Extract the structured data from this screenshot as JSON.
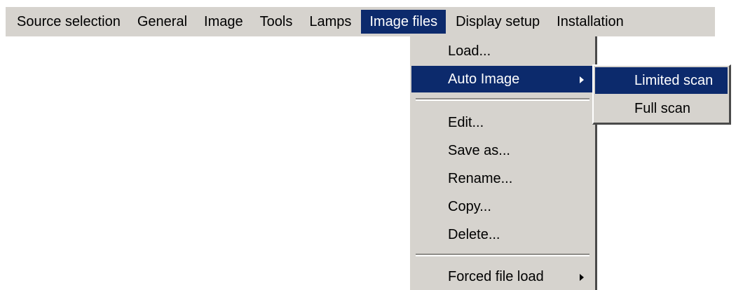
{
  "menubar": {
    "items": [
      {
        "label": "Source selection"
      },
      {
        "label": "General"
      },
      {
        "label": "Image"
      },
      {
        "label": "Tools"
      },
      {
        "label": "Lamps"
      },
      {
        "label": "Image files"
      },
      {
        "label": "Display setup"
      },
      {
        "label": "Installation"
      }
    ],
    "active_index": 5
  },
  "image_files_menu": {
    "items": [
      {
        "label": "Load..."
      },
      {
        "label": "Auto Image",
        "has_submenu": true
      },
      {
        "label": "Edit..."
      },
      {
        "label": "Save as..."
      },
      {
        "label": "Rename..."
      },
      {
        "label": "Copy..."
      },
      {
        "label": "Delete..."
      },
      {
        "label": "Forced file load",
        "has_submenu": true
      }
    ]
  },
  "auto_image_submenu": {
    "items": [
      {
        "label": "Limited scan"
      },
      {
        "label": "Full scan"
      }
    ]
  },
  "colors": {
    "menu_background": "#d6d3ce",
    "highlight": "#0c2a6c",
    "highlight_text": "#ffffff"
  }
}
